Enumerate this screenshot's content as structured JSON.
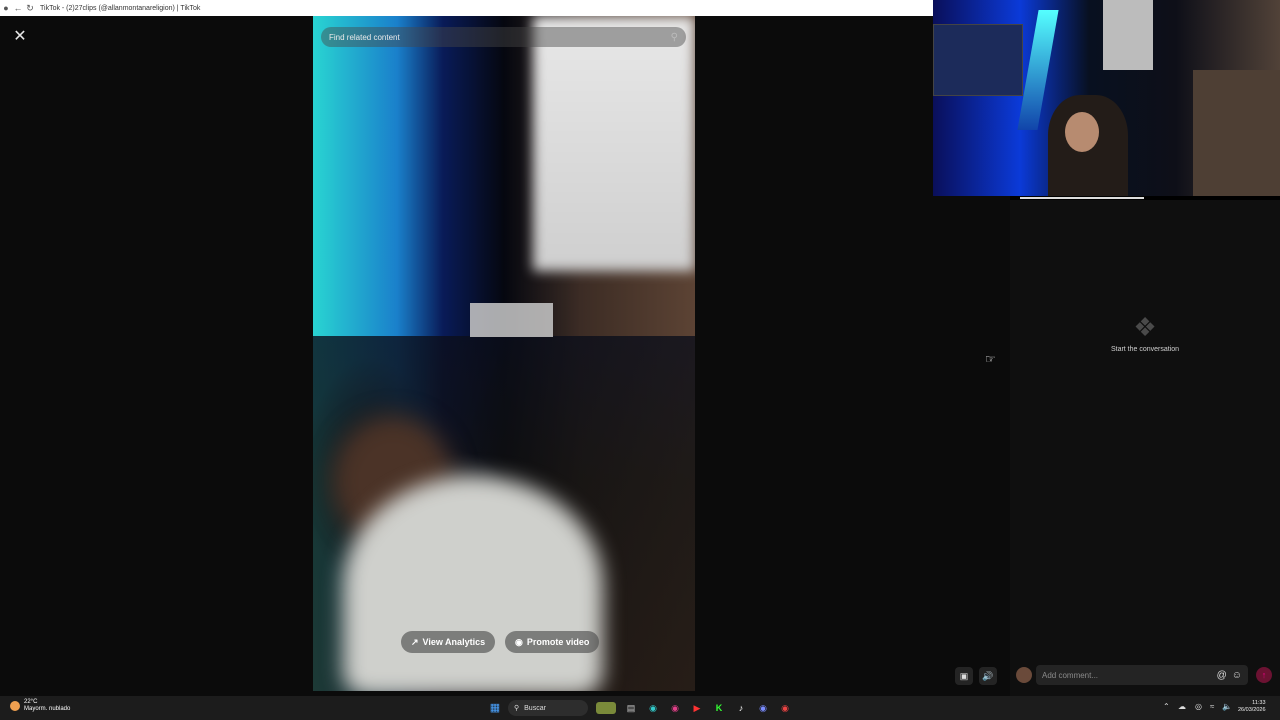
{
  "browser": {
    "title": "TikTok - (2)27clips (@allanmontanareligion) | TikTok"
  },
  "search": {
    "placeholder": "Find related content"
  },
  "video_actions": {
    "analytics_label": "View Analytics",
    "promote_label": "Promote video"
  },
  "comments": {
    "empty_text": "Start the conversation",
    "input_placeholder": "Add comment..."
  },
  "taskbar": {
    "weather_temp": "22°C",
    "weather_desc": "Mayorm. nublado",
    "search_label": "Buscar",
    "time": "11:33",
    "date": "26/03/2026"
  },
  "colors": {
    "post_button": "#6b1232",
    "background": "#000000"
  }
}
